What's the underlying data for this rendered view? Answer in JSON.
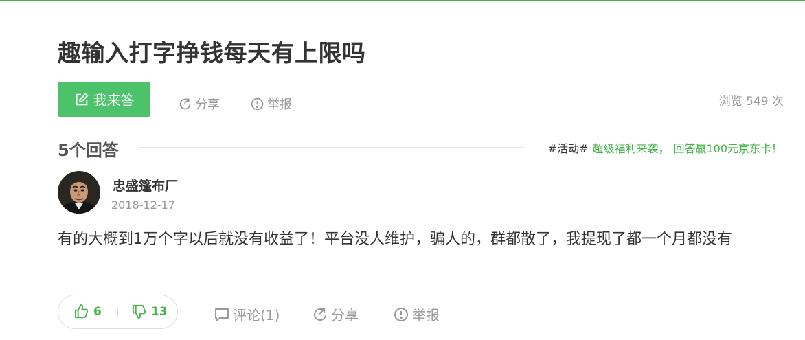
{
  "question": {
    "title": "趣输入打字挣钱每天有上限吗",
    "answer_button": "我来答",
    "share": "分享",
    "report": "举报",
    "views": "浏览 549 次"
  },
  "answers_header": {
    "count_label": "5个回答",
    "promo_tag": "#活动#",
    "promo_link_1": "超级福利来袭，",
    "promo_link_2": "回答赢100元京东卡！"
  },
  "answer": {
    "author": "忠盛篷布厂",
    "date": "2018-12-17",
    "text": "有的大概到1万个字以后就没有收益了！平台没人维护，骗人的，群都散了，我提现了都一个月都没有",
    "likes": "6",
    "dislikes": "13",
    "comment": "评论(1)",
    "share": "分享",
    "report": "举报"
  },
  "colors": {
    "accent": "#44b549",
    "button_bg": "#4cc36a",
    "muted": "#999999"
  }
}
